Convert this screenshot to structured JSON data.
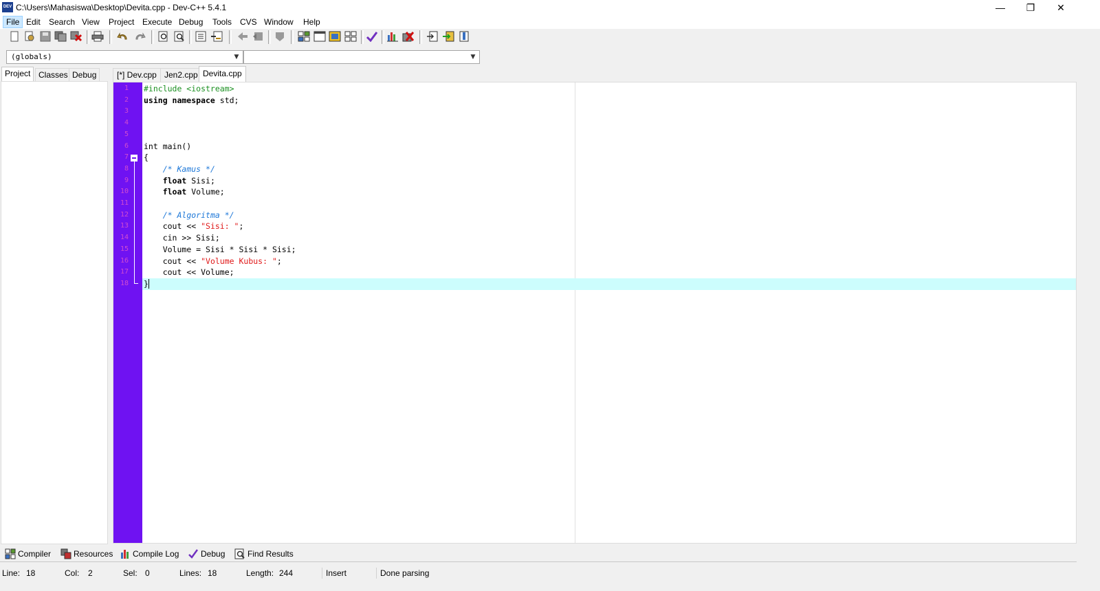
{
  "window": {
    "title": "C:\\Users\\Mahasiswa\\Desktop\\Devita.cpp - Dev-C++ 5.4.1",
    "icon_text": "DEV",
    "minimize": "—",
    "restore": "❐",
    "close": "✕"
  },
  "menu": [
    "File",
    "Edit",
    "Search",
    "View",
    "Project",
    "Execute",
    "Debug",
    "Tools",
    "CVS",
    "Window",
    "Help"
  ],
  "toolbar": {
    "icons": [
      "new-file-icon",
      "open-icon",
      "save-icon",
      "save-all-icon",
      "close-icon",
      "print-icon",
      "undo-icon",
      "redo-icon",
      "find-icon",
      "replace-icon",
      "indent-icon",
      "unindent-icon",
      "back-icon",
      "forward-icon",
      "toggle-icon",
      "new-project-icon",
      "window-icon",
      "insert-icon",
      "classes-icon",
      "check-icon",
      "chart-icon",
      "delete-icon",
      "goto-icon",
      "import-icon",
      "bookmark-icon"
    ]
  },
  "combos": {
    "scope": "(globals)",
    "function": ""
  },
  "left_tabs": [
    "Project",
    "Classes",
    "Debug"
  ],
  "editor_tabs": [
    "[*] Dev.cpp",
    "Jen2.cpp",
    "Devita.cpp"
  ],
  "code": {
    "line_numbers": [
      "1",
      "2",
      "3",
      "4",
      "5",
      "6",
      "7",
      "8",
      "9",
      "10",
      "11",
      "12",
      "13",
      "14",
      "15",
      "16",
      "17",
      "18"
    ],
    "lines": {
      "l1": "#include <iostream>",
      "l2_kw": "using namespace",
      "l2_rest": " std;",
      "l6": "int main()",
      "l7": "{",
      "l8": "/* Kamus */",
      "l9_kw": "float",
      "l9_rest": " Sisi;",
      "l10_kw": "float",
      "l10_rest": " Volume;",
      "l12": "/* Algoritma */",
      "l13_a": "cout << ",
      "l13_s": "\"Sisi: \"",
      "l13_b": ";",
      "l14": "cin >> Sisi;",
      "l15": "Volume = Sisi * Sisi * Sisi;",
      "l16_a": "cout << ",
      "l16_s": "\"Volume Kubus: \"",
      "l16_b": ";",
      "l17": "cout << Volume;",
      "l18": "}"
    }
  },
  "bottom_tabs": [
    "Compiler",
    "Resources",
    "Compile Log",
    "Debug",
    "Find Results"
  ],
  "status": {
    "line_label": "Line:",
    "line_value": "18",
    "col_label": "Col:",
    "col_value": "2",
    "sel_label": "Sel:",
    "sel_value": "0",
    "lines_label": "Lines:",
    "lines_value": "18",
    "length_label": "Length:",
    "length_value": "244",
    "mode": "Insert",
    "message": "Done parsing"
  },
  "colors": {
    "gutter": "#6f12f2",
    "line_number": "#d04dd0",
    "current_line": "#ccfdfd",
    "preprocessor": "#1a9020",
    "comment": "#1e78d8",
    "string": "#e01818"
  }
}
